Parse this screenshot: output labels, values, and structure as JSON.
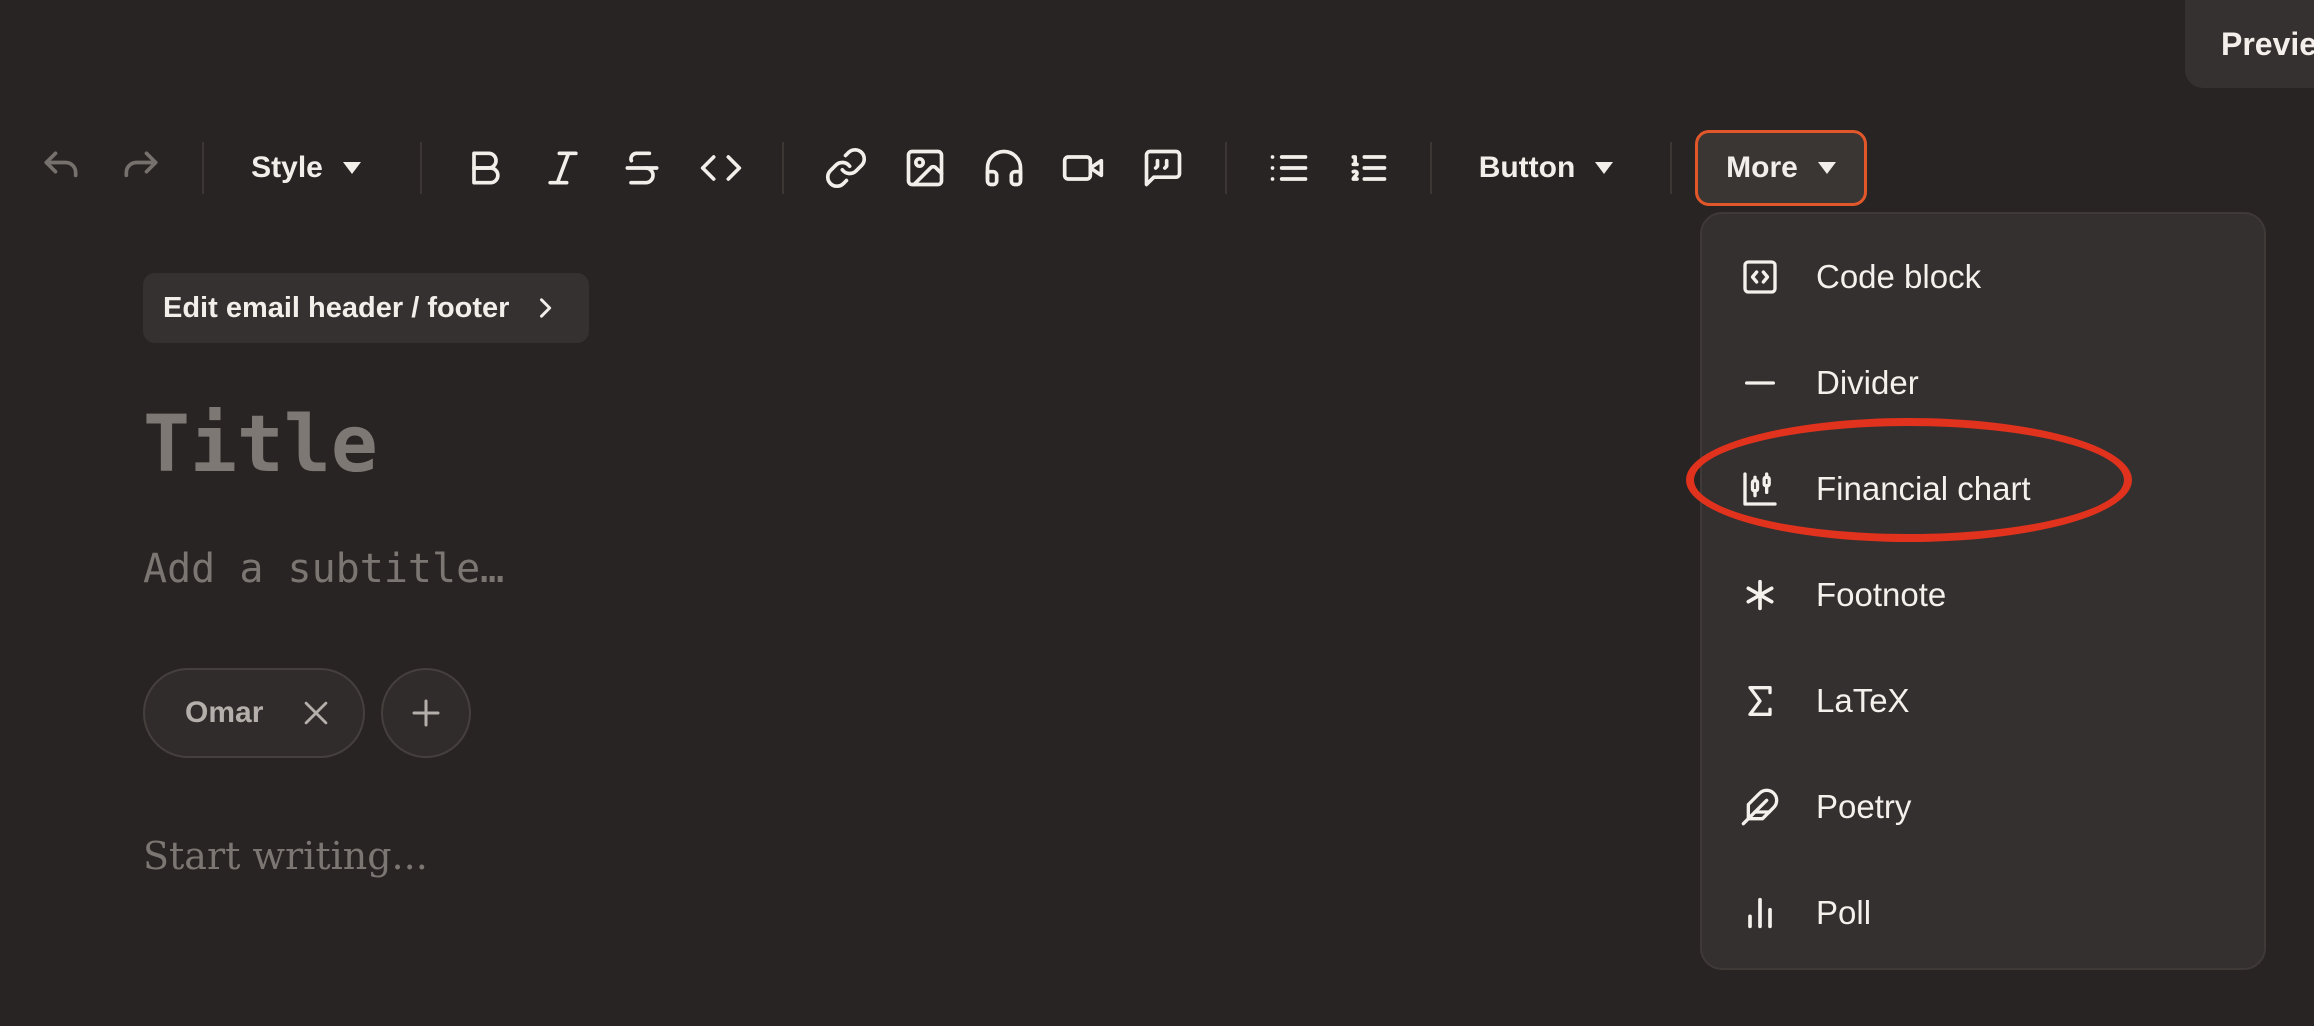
{
  "header": {
    "preview_label": "Previe"
  },
  "toolbar": {
    "style_label": "Style",
    "button_label": "Button",
    "more_label": "More"
  },
  "editor": {
    "edit_header_footer": "Edit email header / footer",
    "title_placeholder": "Title",
    "subtitle_placeholder": "Add a subtitle…",
    "author": "Omar",
    "body_placeholder": "Start writing..."
  },
  "more_menu": {
    "items": [
      {
        "label": "Code block",
        "icon": "code-block-icon"
      },
      {
        "label": "Divider",
        "icon": "divider-icon"
      },
      {
        "label": "Financial chart",
        "icon": "financial-chart-icon"
      },
      {
        "label": "Footnote",
        "icon": "asterisk-icon"
      },
      {
        "label": "LaTeX",
        "icon": "sigma-icon"
      },
      {
        "label": "Poetry",
        "icon": "feather-icon"
      },
      {
        "label": "Poll",
        "icon": "poll-icon"
      }
    ]
  },
  "colors": {
    "background": "#282423",
    "accent_outline": "#e2572a",
    "highlight_ring": "#e0321c"
  }
}
